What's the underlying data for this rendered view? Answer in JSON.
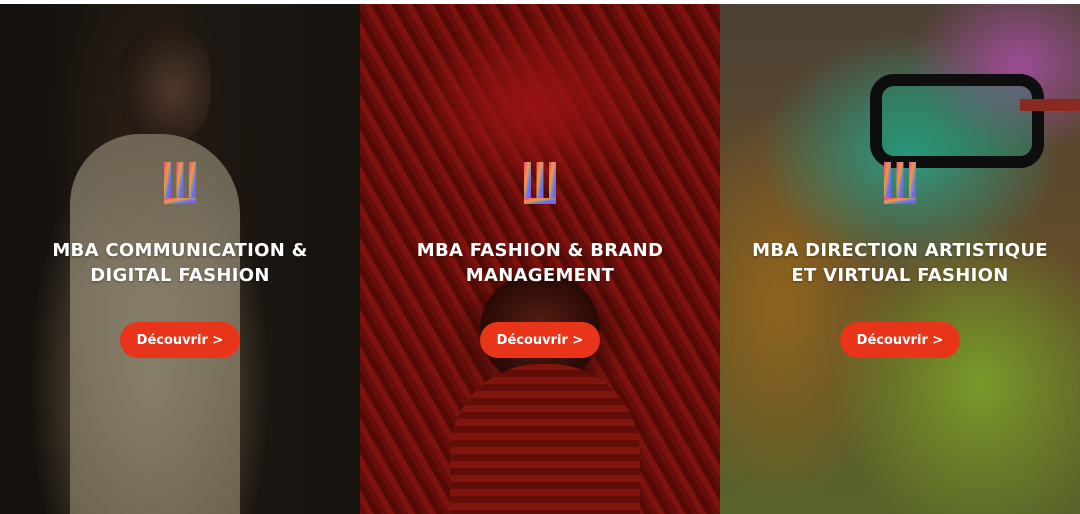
{
  "programs": [
    {
      "title": "MBA COMMUNICATION & DIGITAL FASHION",
      "button_label": "Découvrir >"
    },
    {
      "title": "MBA FASHION & BRAND MANAGEMENT",
      "button_label": "Découvrir >"
    },
    {
      "title": "MBA DIRECTION ARTISTIQUE ET VIRTUAL FASHION",
      "button_label": "Découvrir >"
    }
  ],
  "colors": {
    "button": "#e8351a",
    "title_text": "#ffffff"
  },
  "icons": {
    "brand_logo": "brand-logo-icon"
  }
}
